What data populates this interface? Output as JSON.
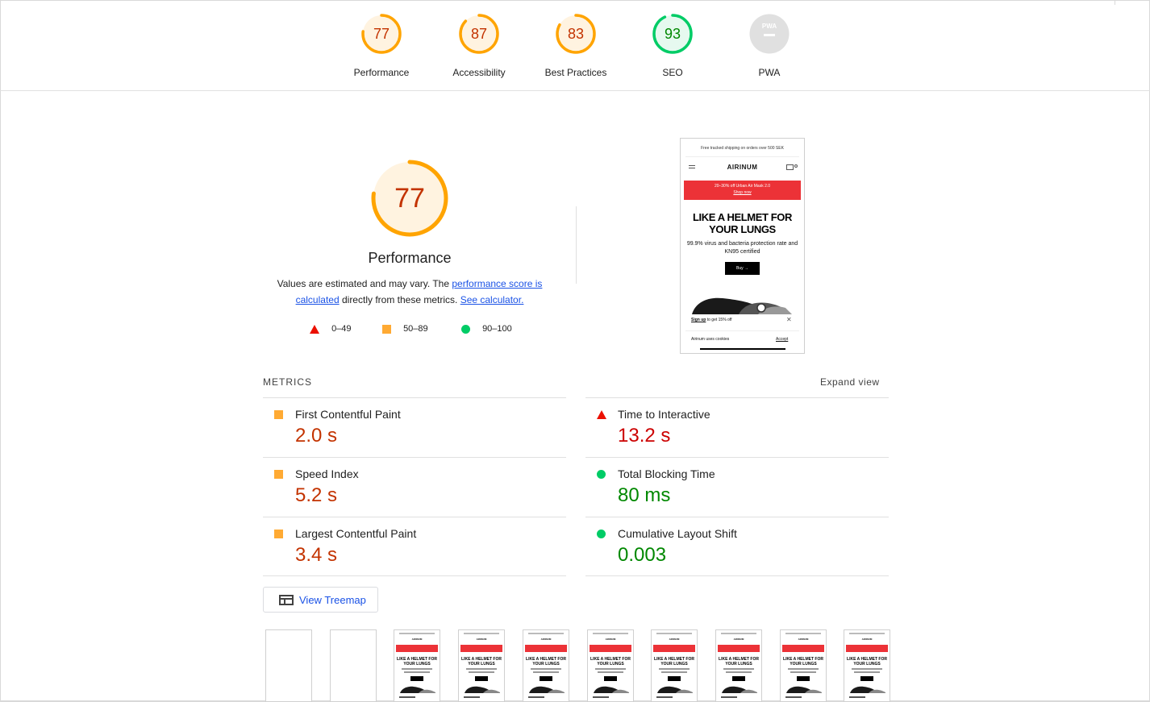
{
  "categories": [
    {
      "label": "Performance",
      "score": "77",
      "rating": "orange"
    },
    {
      "label": "Accessibility",
      "score": "87",
      "rating": "orange"
    },
    {
      "label": "Best Practices",
      "score": "83",
      "rating": "orange"
    },
    {
      "label": "SEO",
      "score": "93",
      "rating": "green"
    },
    {
      "label": "PWA",
      "score": "",
      "rating": "na",
      "badge": "PWA"
    }
  ],
  "main": {
    "score": "77",
    "title": "Performance",
    "desc_prefix": "Values are estimated and may vary. The ",
    "desc_link1": "performance score is calculated",
    "desc_middle": " directly from these metrics. ",
    "desc_link2": "See calculator."
  },
  "legend": {
    "fail": "0–49",
    "average": "50–89",
    "pass": "90–100"
  },
  "screenshot": {
    "shipping": "Free tracked shipping on orders over 500 SEK",
    "logo": "AIRINUM",
    "banner_line1": "20–30% off Urban Air Mask 2.0",
    "banner_line2": "Shop now",
    "headline": "LIKE A HELMET FOR YOUR LUNGS",
    "subhead": "99.9% virus and bacteria protection rate and KN95 certified",
    "buy": "Buy  →",
    "signup_link": "Sign up",
    "signup_text": " to get 15% off",
    "close": "✕",
    "cookies": "Airinum uses cookies",
    "accept": "Accept"
  },
  "metrics": {
    "header": "METRICS",
    "expand": "Expand view",
    "items": [
      {
        "name": "First Contentful Paint",
        "value": "2.0 s",
        "rating": "average"
      },
      {
        "name": "Time to Interactive",
        "value": "13.2 s",
        "rating": "fail"
      },
      {
        "name": "Speed Index",
        "value": "5.2 s",
        "rating": "average"
      },
      {
        "name": "Total Blocking Time",
        "value": "80 ms",
        "rating": "pass"
      },
      {
        "name": "Largest Contentful Paint",
        "value": "3.4 s",
        "rating": "average"
      },
      {
        "name": "Cumulative Layout Shift",
        "value": "0.003",
        "rating": "pass"
      }
    ]
  },
  "treemap": {
    "label": "View Treemap"
  },
  "filmstrip": {
    "frames": [
      "blank",
      "blank",
      "page",
      "page",
      "page",
      "page",
      "page",
      "page",
      "page",
      "page"
    ],
    "logo": "AIRINUM",
    "headline": "LIKE A HELMET FOR YOUR LUNGS"
  },
  "colors": {
    "orange_ring": "#ffa400",
    "orange_text": "#c33300",
    "orange_fill": "#fff3e0",
    "green_ring": "#00cc66",
    "green_text": "#008800",
    "green_fill": "#e6f9ef",
    "red_text": "#cc0000",
    "link": "#1a52e6"
  }
}
